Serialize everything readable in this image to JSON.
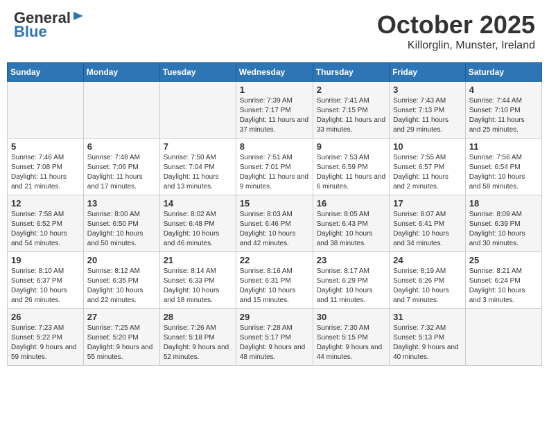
{
  "header": {
    "logo_line1": "General",
    "logo_line2": "Blue",
    "month_title": "October 2025",
    "subtitle": "Killorglin, Munster, Ireland"
  },
  "days_of_week": [
    "Sunday",
    "Monday",
    "Tuesday",
    "Wednesday",
    "Thursday",
    "Friday",
    "Saturday"
  ],
  "weeks": [
    [
      {
        "num": "",
        "info": ""
      },
      {
        "num": "",
        "info": ""
      },
      {
        "num": "",
        "info": ""
      },
      {
        "num": "1",
        "info": "Sunrise: 7:39 AM\nSunset: 7:17 PM\nDaylight: 11 hours and 37 minutes."
      },
      {
        "num": "2",
        "info": "Sunrise: 7:41 AM\nSunset: 7:15 PM\nDaylight: 11 hours and 33 minutes."
      },
      {
        "num": "3",
        "info": "Sunrise: 7:43 AM\nSunset: 7:13 PM\nDaylight: 11 hours and 29 minutes."
      },
      {
        "num": "4",
        "info": "Sunrise: 7:44 AM\nSunset: 7:10 PM\nDaylight: 11 hours and 25 minutes."
      }
    ],
    [
      {
        "num": "5",
        "info": "Sunrise: 7:46 AM\nSunset: 7:08 PM\nDaylight: 11 hours and 21 minutes."
      },
      {
        "num": "6",
        "info": "Sunrise: 7:48 AM\nSunset: 7:06 PM\nDaylight: 11 hours and 17 minutes."
      },
      {
        "num": "7",
        "info": "Sunrise: 7:50 AM\nSunset: 7:04 PM\nDaylight: 11 hours and 13 minutes."
      },
      {
        "num": "8",
        "info": "Sunrise: 7:51 AM\nSunset: 7:01 PM\nDaylight: 11 hours and 9 minutes."
      },
      {
        "num": "9",
        "info": "Sunrise: 7:53 AM\nSunset: 6:59 PM\nDaylight: 11 hours and 6 minutes."
      },
      {
        "num": "10",
        "info": "Sunrise: 7:55 AM\nSunset: 6:57 PM\nDaylight: 11 hours and 2 minutes."
      },
      {
        "num": "11",
        "info": "Sunrise: 7:56 AM\nSunset: 6:54 PM\nDaylight: 10 hours and 58 minutes."
      }
    ],
    [
      {
        "num": "12",
        "info": "Sunrise: 7:58 AM\nSunset: 6:52 PM\nDaylight: 10 hours and 54 minutes."
      },
      {
        "num": "13",
        "info": "Sunrise: 8:00 AM\nSunset: 6:50 PM\nDaylight: 10 hours and 50 minutes."
      },
      {
        "num": "14",
        "info": "Sunrise: 8:02 AM\nSunset: 6:48 PM\nDaylight: 10 hours and 46 minutes."
      },
      {
        "num": "15",
        "info": "Sunrise: 8:03 AM\nSunset: 6:46 PM\nDaylight: 10 hours and 42 minutes."
      },
      {
        "num": "16",
        "info": "Sunrise: 8:05 AM\nSunset: 6:43 PM\nDaylight: 10 hours and 38 minutes."
      },
      {
        "num": "17",
        "info": "Sunrise: 8:07 AM\nSunset: 6:41 PM\nDaylight: 10 hours and 34 minutes."
      },
      {
        "num": "18",
        "info": "Sunrise: 8:09 AM\nSunset: 6:39 PM\nDaylight: 10 hours and 30 minutes."
      }
    ],
    [
      {
        "num": "19",
        "info": "Sunrise: 8:10 AM\nSunset: 6:37 PM\nDaylight: 10 hours and 26 minutes."
      },
      {
        "num": "20",
        "info": "Sunrise: 8:12 AM\nSunset: 6:35 PM\nDaylight: 10 hours and 22 minutes."
      },
      {
        "num": "21",
        "info": "Sunrise: 8:14 AM\nSunset: 6:33 PM\nDaylight: 10 hours and 18 minutes."
      },
      {
        "num": "22",
        "info": "Sunrise: 8:16 AM\nSunset: 6:31 PM\nDaylight: 10 hours and 15 minutes."
      },
      {
        "num": "23",
        "info": "Sunrise: 8:17 AM\nSunset: 6:29 PM\nDaylight: 10 hours and 11 minutes."
      },
      {
        "num": "24",
        "info": "Sunrise: 8:19 AM\nSunset: 6:26 PM\nDaylight: 10 hours and 7 minutes."
      },
      {
        "num": "25",
        "info": "Sunrise: 8:21 AM\nSunset: 6:24 PM\nDaylight: 10 hours and 3 minutes."
      }
    ],
    [
      {
        "num": "26",
        "info": "Sunrise: 7:23 AM\nSunset: 5:22 PM\nDaylight: 9 hours and 59 minutes."
      },
      {
        "num": "27",
        "info": "Sunrise: 7:25 AM\nSunset: 5:20 PM\nDaylight: 9 hours and 55 minutes."
      },
      {
        "num": "28",
        "info": "Sunrise: 7:26 AM\nSunset: 5:18 PM\nDaylight: 9 hours and 52 minutes."
      },
      {
        "num": "29",
        "info": "Sunrise: 7:28 AM\nSunset: 5:17 PM\nDaylight: 9 hours and 48 minutes."
      },
      {
        "num": "30",
        "info": "Sunrise: 7:30 AM\nSunset: 5:15 PM\nDaylight: 9 hours and 44 minutes."
      },
      {
        "num": "31",
        "info": "Sunrise: 7:32 AM\nSunset: 5:13 PM\nDaylight: 9 hours and 40 minutes."
      },
      {
        "num": "",
        "info": ""
      }
    ]
  ]
}
